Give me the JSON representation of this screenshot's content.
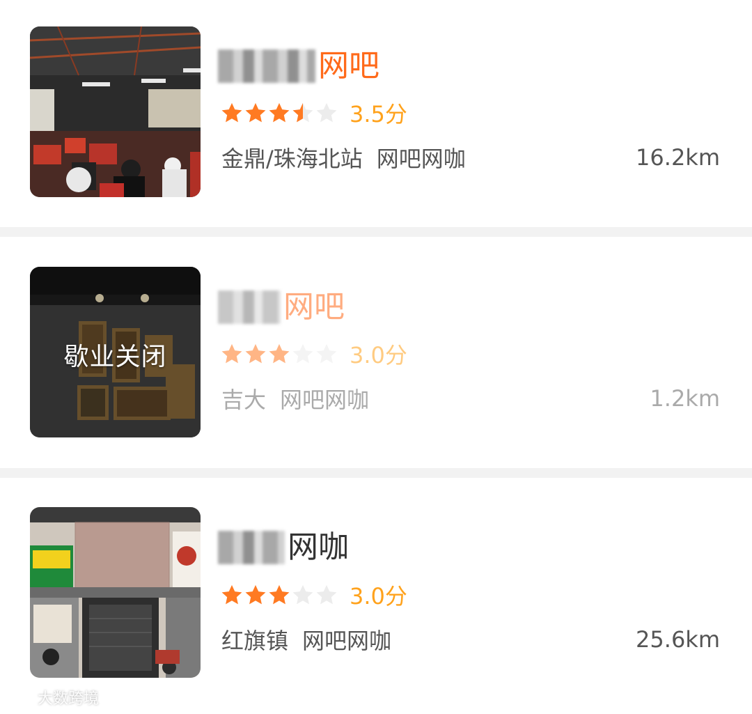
{
  "colors": {
    "accent_orange": "#ff6a1a",
    "star_orange": "#ff7a22",
    "star_empty": "#ececec",
    "score_color": "#ffa21c",
    "text_dark": "#333333",
    "text_gray": "#555555",
    "separator": "#f2f2f2"
  },
  "listings": [
    {
      "name_suffix": "网吧",
      "rating": 3.5,
      "score_text": "3.5分",
      "area": "金鼎/珠海北站",
      "category": "网吧网咖",
      "distance": "16.2km",
      "closed": false,
      "closed_label": "",
      "image": "internet-cafe-interior-photo"
    },
    {
      "name_suffix": "网吧",
      "rating": 3.0,
      "score_text": "3.0分",
      "area": "吉大",
      "category": "网吧网咖",
      "distance": "1.2km",
      "closed": true,
      "closed_label": "歇业关闭",
      "image": "dark-wall-with-frames-photo"
    },
    {
      "name_suffix": "网咖",
      "rating": 3.0,
      "score_text": "3.0分",
      "area": "红旗镇",
      "category": "网吧网咖",
      "distance": "25.6km",
      "closed": false,
      "closed_label": "",
      "image": "storefront-exterior-photo"
    }
  ],
  "watermark": {
    "text": "大数跨境",
    "icon": "brand-logo-icon"
  }
}
